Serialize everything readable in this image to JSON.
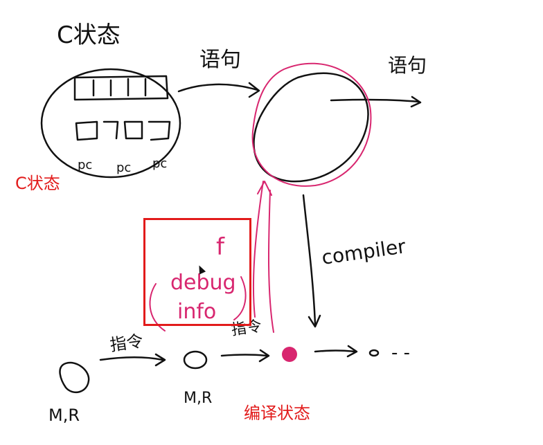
{
  "colors": {
    "ink": "#111111",
    "pen_pink": "#d8266f",
    "annotation_red": "#e21b1b"
  },
  "handwriting": {
    "c_state_title": "C状态",
    "arrow_label_top": "语句",
    "arrow_label_right": "语句",
    "pc_labels": [
      "pc",
      "pc",
      "pc"
    ],
    "compiler": "compiler",
    "f": "f",
    "debug": "debug",
    "info": "info",
    "step_label_left": "指令",
    "step_label_right": "指令",
    "mr_left": "M,R",
    "mr_middle": "M,R",
    "ellipsis": "- -"
  },
  "annotations": {
    "c_state": "C状态",
    "compile_state": "编译状态"
  },
  "icons": {
    "cursor": "mouse-pointer-icon"
  }
}
